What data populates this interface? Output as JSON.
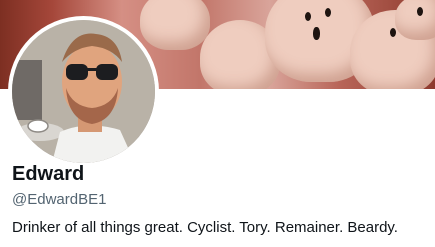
{
  "profile": {
    "name": "Edward",
    "handle": "@EdwardBE1",
    "bio": "Drinker of all things great. Cyclist. Tory. Remainer. Beardy."
  }
}
